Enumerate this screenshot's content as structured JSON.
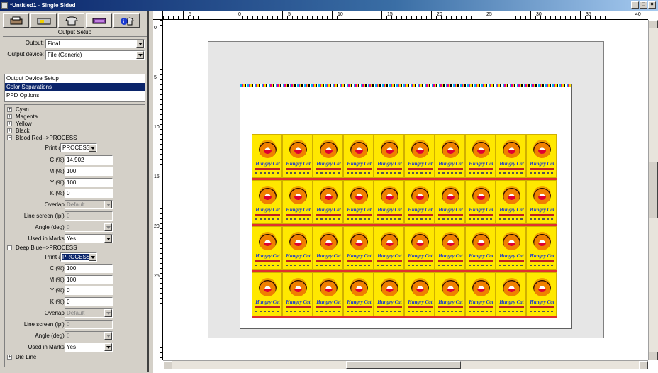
{
  "window": {
    "title": "*Untitled1 - Single Sided",
    "minimize_glyph": "_",
    "maximize_glyph": "□",
    "close_glyph": "×"
  },
  "tabs": [
    {
      "name": "tab-job",
      "icon": "printer-icon"
    },
    {
      "name": "tab-layout",
      "icon": "layout-icon"
    },
    {
      "name": "tab-output",
      "icon": "shirt-icon"
    },
    {
      "name": "tab-marks",
      "icon": "marks-icon"
    },
    {
      "name": "tab-info",
      "icon": "info-icon"
    }
  ],
  "output_setup": {
    "title": "Output Setup",
    "output_label": "Output:",
    "output_value": "Final",
    "device_label": "Output device:",
    "device_value": "File (Generic)",
    "options": [
      "Output Device Setup",
      "Color Separations",
      "PPD Options"
    ],
    "selected_option": "Color Separations"
  },
  "separations": {
    "tree": [
      "Cyan",
      "Magenta",
      "Yellow",
      "Black"
    ],
    "tree_glyph": "+",
    "blood_red": {
      "title": "Blood Red-->PROCESS",
      "print_as_label": "Print as:",
      "print_as": "PROCESS",
      "c_label": "C (%):",
      "c": "14.902",
      "m_label": "M (%):",
      "m": "100",
      "y_label": "Y (%):",
      "y": "100",
      "k_label": "K (%):",
      "k": "0",
      "overlap_label": "Overlap:",
      "overlap": "Default",
      "lpi_label": "Line screen (lpi):",
      "lpi": "0",
      "angle_label": "Angle (deg):",
      "angle": "0",
      "marks_label": "Used in Marks:",
      "marks": "Yes"
    },
    "deep_blue": {
      "title": "Deep Blue-->PROCESS",
      "print_as_label": "Print as:",
      "print_as": "PROCESS",
      "c_label": "C (%):",
      "c": "100",
      "m_label": "M (%):",
      "m": "100",
      "y_label": "Y (%):",
      "y": "0",
      "k_label": "K (%):",
      "k": "0",
      "overlap_label": "Overlap:",
      "overlap": "Default",
      "lpi_label": "Line screen (lpi):",
      "lpi": "0",
      "angle_label": "Angle (deg):",
      "angle": "0",
      "marks_label": "Used in Marks:",
      "marks": "Yes"
    },
    "die_line": "Die Line"
  },
  "ruler": {
    "h_labels": [
      "5",
      "0",
      "5",
      "10",
      "15",
      "20",
      "25",
      "30",
      "35",
      "40"
    ],
    "v_labels": [
      "0",
      "5",
      "10",
      "15",
      "20",
      "25"
    ]
  },
  "label_art": {
    "brand": "Hungry Cat"
  },
  "colors": {
    "selection": "#0a246a",
    "label_yellow": "#ffe800",
    "brand_blue": "#1a3ad0",
    "strip_red": "#e03030"
  }
}
